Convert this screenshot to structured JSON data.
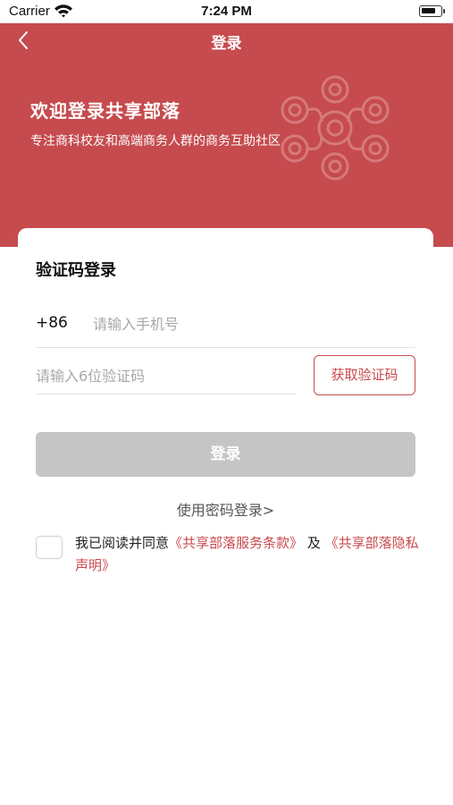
{
  "status_bar": {
    "carrier": "Carrier",
    "time": "7:24 PM",
    "battery_level": 0.8
  },
  "nav": {
    "title": "登录",
    "back_icon": "chevron-left-icon"
  },
  "header": {
    "welcome_title": "欢迎登录共享部落",
    "welcome_sub": "专注商科校友和高端商务人群的商务互助社区",
    "emblem_icon": "cloud-pattern-emblem",
    "background_color": "#c64b4e"
  },
  "form": {
    "title": "验证码登录",
    "country_code": "+86",
    "phone_placeholder": "请输入手机号",
    "code_placeholder": "请输入6位验证码",
    "get_code_label": "获取验证码",
    "login_label": "登录",
    "password_login_label": "使用密码登录>",
    "accent_color": "#c9494c"
  },
  "agreement": {
    "prefix": "我已阅读并同意",
    "terms_link": "《共享部落服务条款》",
    "conjunction": "及",
    "privacy_link": "《共享部落隐私声明》",
    "checked": false
  }
}
